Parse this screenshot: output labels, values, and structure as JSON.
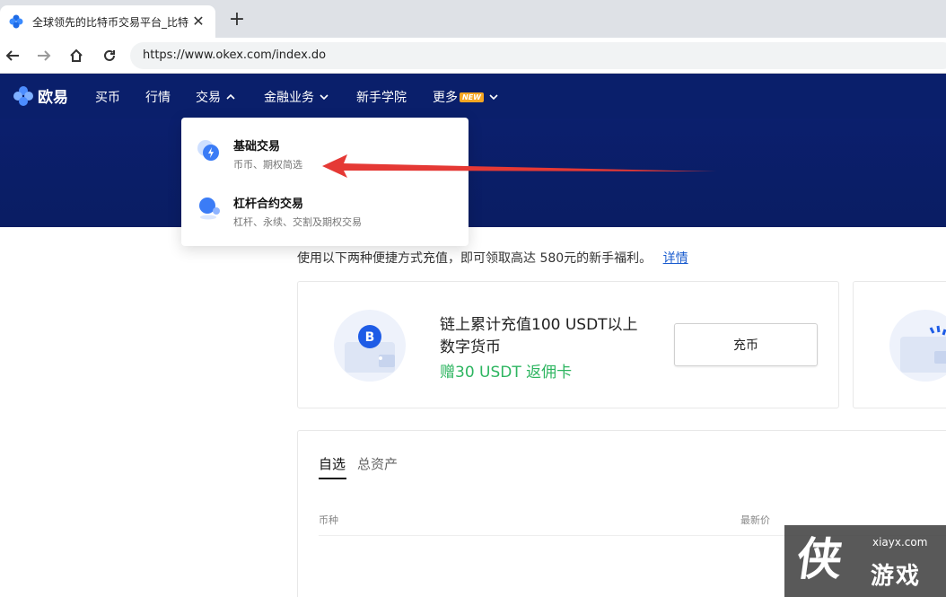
{
  "browser": {
    "tab_title": "全球领先的比特币交易平台_比特",
    "url": "https://www.okex.com/index.do"
  },
  "site_nav": {
    "logo": "欧易",
    "items": [
      {
        "label": "买币"
      },
      {
        "label": "行情"
      },
      {
        "label": "交易"
      },
      {
        "label": "金融业务"
      },
      {
        "label": "新手学院"
      },
      {
        "label": "更多"
      }
    ],
    "new_badge": "NEW"
  },
  "dropdown": {
    "items": [
      {
        "title": "基础交易",
        "subtitle": "币币、期权简选"
      },
      {
        "title": "杠杆合约交易",
        "subtitle": "杠杆、永续、交割及期权交易"
      }
    ]
  },
  "promo": {
    "text": "使用以下两种便捷方式充值，即可领取高达 580元的新手福利。",
    "link": "详情"
  },
  "card": {
    "line1": "链上累计充值100 USDT以上",
    "line2": "数字货币",
    "bonus": "赠30 USDT 返佣卡",
    "button": "充币"
  },
  "assets": {
    "tabs": [
      "自选",
      "总资产"
    ],
    "col_coin": "币种",
    "col_price": "最新价"
  },
  "watermark": {
    "glyph": "侠",
    "domain": "xiayx.com",
    "text": "游戏"
  },
  "colors": {
    "nav_bg": "#0a1f6b",
    "accent_green": "#2db560",
    "link_blue": "#1a5ccf",
    "arrow_red": "#e53935"
  }
}
